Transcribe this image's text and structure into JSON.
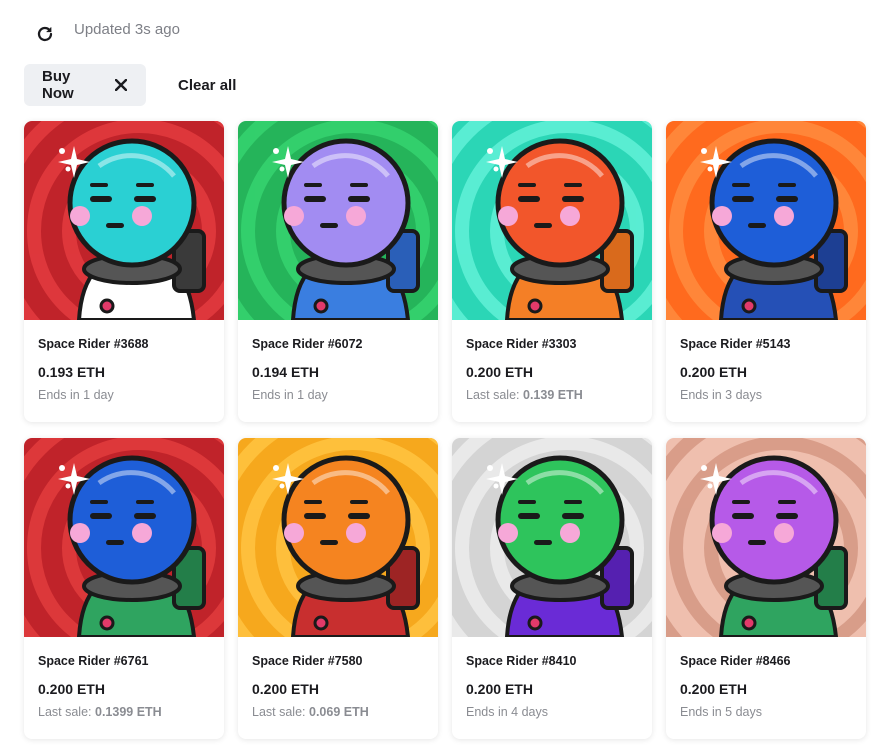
{
  "header": {
    "updated_text": "Updated 3s ago"
  },
  "filters": {
    "active_chip_label": "Buy Now",
    "clear_label": "Clear all"
  },
  "cards": [
    {
      "name": "Space Rider #3688",
      "price": "0.193",
      "unit": "ETH",
      "sub_label": "Ends in 1 day",
      "sub_value": "",
      "bg": "#c0232a",
      "stripe": "#e23a3e",
      "head": "#2ad0d3",
      "suit": "#ffffff",
      "trim": "#3a3a3a"
    },
    {
      "name": "Space Rider #6072",
      "price": "0.194",
      "unit": "ETH",
      "sub_label": "Ends in 1 day",
      "sub_value": "",
      "bg": "#25b45a",
      "stripe": "#35d26e",
      "head": "#a28cf2",
      "suit": "#3a7ee0",
      "trim": "#2a5fb8"
    },
    {
      "name": "Space Rider #3303",
      "price": "0.200",
      "unit": "ETH",
      "sub_label": "Last sale:",
      "sub_value": "0.139 ETH",
      "bg": "#2bd6b6",
      "stripe": "#5ff0d6",
      "head": "#f2562b",
      "suit": "#f47f26",
      "trim": "#d96a1c"
    },
    {
      "name": "Space Rider #5143",
      "price": "0.200",
      "unit": "ETH",
      "sub_label": "Ends in 3 days",
      "sub_value": "",
      "bg": "#ff6a1e",
      "stripe": "#ff8a3c",
      "head": "#1e5ed8",
      "suit": "#2550b6",
      "trim": "#1d3f93"
    },
    {
      "name": "Space Rider #6761",
      "price": "0.200",
      "unit": "ETH",
      "sub_label": "Last sale:",
      "sub_value": "0.1399 ETH",
      "bg": "#c0232a",
      "stripe": "#e03b3c",
      "head": "#1e5ed8",
      "suit": "#2fa460",
      "trim": "#237e49"
    },
    {
      "name": "Space Rider #7580",
      "price": "0.200",
      "unit": "ETH",
      "sub_label": "Last sale:",
      "sub_value": "0.069 ETH",
      "bg": "#f6a81d",
      "stripe": "#ffc240",
      "head": "#f58420",
      "suit": "#c82f2f",
      "trim": "#9d2424"
    },
    {
      "name": "Space Rider #8410",
      "price": "0.200",
      "unit": "ETH",
      "sub_label": "Ends in 4 days",
      "sub_value": "",
      "bg": "#d4d4d4",
      "stripe": "#ececec",
      "head": "#2ec45c",
      "suit": "#6a2bd6",
      "trim": "#5520b0"
    },
    {
      "name": "Space Rider #8466",
      "price": "0.200",
      "unit": "ETH",
      "sub_label": "Ends in 5 days",
      "sub_value": "",
      "bg": "#efbfae",
      "stripe": "#d69a86",
      "head": "#b65ae8",
      "suit": "#2fa460",
      "trim": "#237e49"
    }
  ]
}
